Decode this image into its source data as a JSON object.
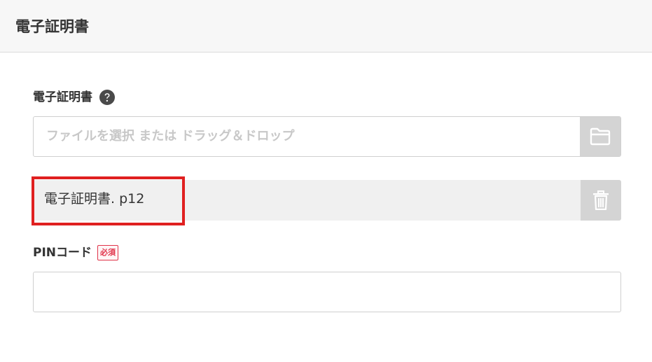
{
  "header": {
    "title": "電子証明書"
  },
  "certificate_field": {
    "label": "電子証明書",
    "help_icon": "question-circle-icon",
    "placeholder": "ファイルを選択 または ドラッグ＆ドロップ",
    "browse_icon": "folder-icon",
    "selected_file": "電子証明書. p12",
    "delete_icon": "trash-icon"
  },
  "pin_field": {
    "label": "PINコード",
    "required_badge": "必須",
    "value": ""
  },
  "colors": {
    "header_bg": "#f7f7f7",
    "button_bg": "#d4d4d4",
    "file_item_bg": "#f0f0f0",
    "required": "#e0334a",
    "highlight": "#e02020",
    "placeholder": "#c8c8c8"
  }
}
